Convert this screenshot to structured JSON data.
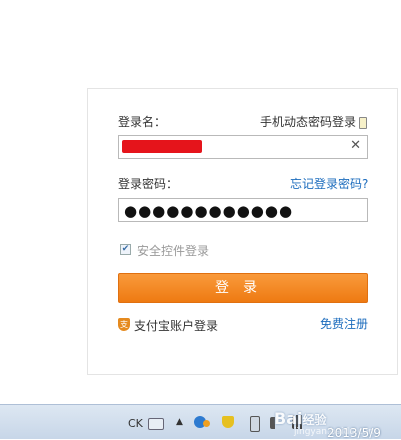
{
  "login": {
    "username_label": "登录名：",
    "phone_login_link": "手机动态密码登录",
    "clear_symbol": "✕",
    "password_label": "登录密码：",
    "forgot_link": "忘记登录密码?",
    "password_masked": "●●●●●●●●●●●●",
    "security_checkbox_label": "安全控件登录",
    "security_checked": true,
    "login_button": "登录",
    "alipay_login": "支付宝账户登录",
    "register_link": "免费注册"
  },
  "taskbar": {
    "ime": "CK",
    "arrow": "▲",
    "watermark": "Bai",
    "watermark_suffix": "经验",
    "watermark_url": "jingyan.baidu.com",
    "date": "2013/5/9"
  },
  "colors": {
    "accent_orange": "#ee7a12",
    "link_blue": "#1c6cbd",
    "redaction": "#e5141b"
  }
}
